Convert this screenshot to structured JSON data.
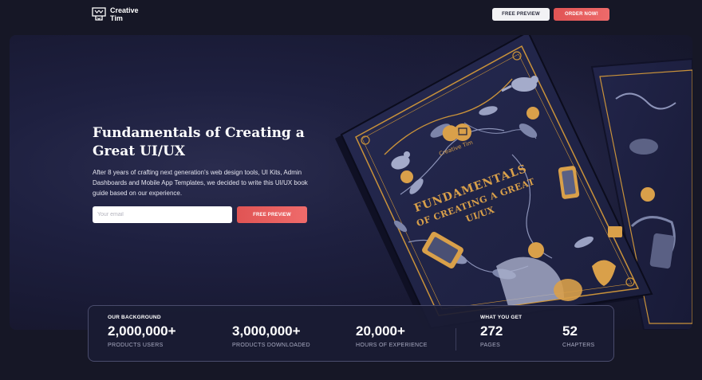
{
  "brand": {
    "line1": "Creative",
    "line2": "Tim"
  },
  "nav": {
    "preview_label": "FREE PREVIEW",
    "order_label": "ORDER NOW!"
  },
  "hero": {
    "title": "Fundamentals of Creating a Great UI/UX",
    "description": "After 8 years of crafting next generation's web design tools, UI Kits, Admin Dashboards and Mobile App Templates, we decided to write this UI/UX book guide based on our experience.",
    "email_placeholder": "Your email",
    "email_value": "",
    "preview_label": "FREE PREVIEW"
  },
  "book": {
    "cover_brand": "Creative Tim",
    "cover_title_line1": "FUNDAMENTALS",
    "cover_title_line2": "OF CREATING A GREAT",
    "cover_title_line3": "UI/UX"
  },
  "stats": {
    "background_label": "OUR BACKGROUND",
    "get_label": "WHAT YOU GET",
    "items": [
      {
        "value": "2,000,000+",
        "caption": "PRODUCTS USERS"
      },
      {
        "value": "3,000,000+",
        "caption": "PRODUCTS DOWNLOADED"
      },
      {
        "value": "20,000+",
        "caption": "HOURS OF EXPERIENCE"
      },
      {
        "value": "272",
        "caption": "PAGES"
      },
      {
        "value": "52",
        "caption": "CHAPTERS"
      }
    ]
  },
  "colors": {
    "background": "#161726",
    "hero": "#1e2040",
    "accent": "#e05454",
    "gold": "#c9923a"
  }
}
